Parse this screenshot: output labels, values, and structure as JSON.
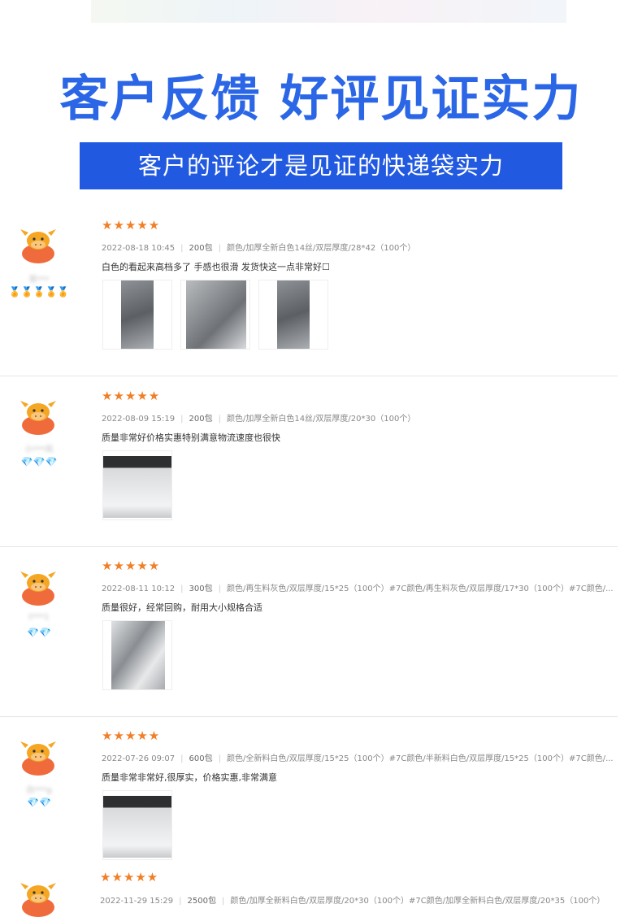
{
  "header": {
    "title": "客户反馈 好评见证实力",
    "subtitle": "客户的评论才是见证的快递袋实力"
  },
  "reviews": [
    {
      "rating": "★★★★★",
      "date": "2022-08-18 10:45",
      "qty": "200包",
      "spec": "颜色/加厚全新白色14丝/双层厚度/28*42（100个）",
      "text": "白色的看起来高档多了 手感也很滑 发货快这一点非常好☐",
      "username": "哥***",
      "badges": "🏅🏅🏅🏅🏅",
      "photos": [
        "bag-photo",
        "bag-pile-photo",
        "bag-photo"
      ]
    },
    {
      "rating": "★★★★★",
      "date": "2022-08-09 15:19",
      "qty": "200包",
      "spec": "颜色/加厚全新白色14丝/双层厚度/20*30（100个）",
      "text": "质量非常好价格实惠特别满意物流速度也很快",
      "username": "小***风",
      "badges": "💎💎💎",
      "photos": [
        "white-bag-photo"
      ]
    },
    {
      "rating": "★★★★★",
      "date": "2022-08-11 10:12",
      "qty": "300包",
      "spec": "颜色/再生料灰色/双层厚度/15*25（100个）#7C颜色/再生料灰色/双层厚度/17*30（100个）#7C颜色/...",
      "text": "质量很好，经常回购，耐用大小规格合适",
      "username": "t***1",
      "badges": "💎💎",
      "photos": [
        "silver-bag-photo"
      ]
    },
    {
      "rating": "★★★★★",
      "date": "2022-07-26 09:07",
      "qty": "600包",
      "spec": "颜色/全新料白色/双层厚度/15*25（100个）#7C颜色/半新料白色/双层厚度/15*25（100个）#7C颜色/...",
      "text": "质量非常非常好,很厚实，价格实惠,非常满意",
      "username": "白***g",
      "badges": "💎💎",
      "photos": [
        "white-bag-photo"
      ]
    },
    {
      "rating": "★★★★★",
      "date": "2022-11-29 15:29",
      "qty": "2500包",
      "spec": "颜色/加厚全新料白色/双层厚度/20*30（100个）#7C颜色/加厚全新料白色/双层厚度/20*35（100个）",
      "text": "",
      "username": "",
      "badges": "",
      "photos": []
    }
  ]
}
